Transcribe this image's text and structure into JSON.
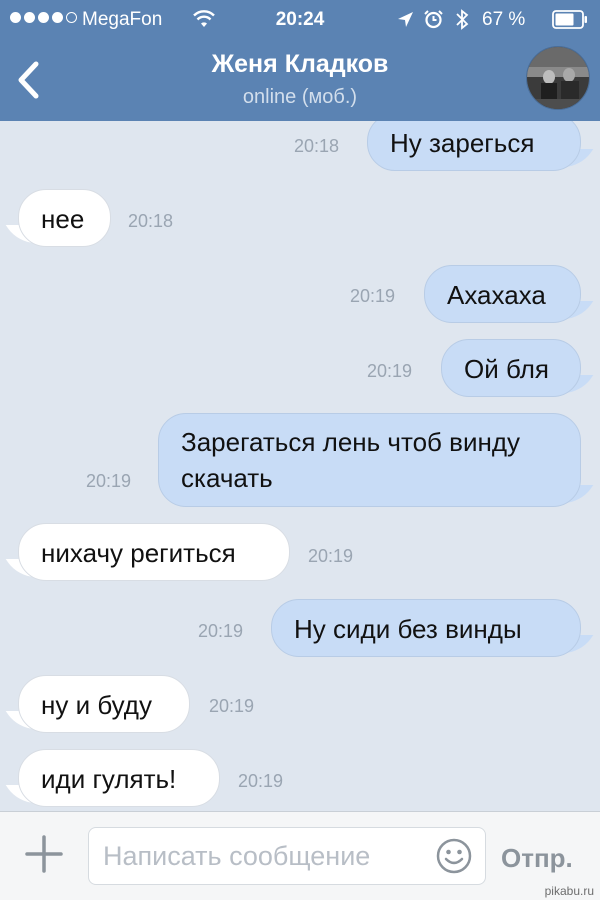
{
  "status_bar": {
    "carrier": "MegaFon",
    "time": "20:24",
    "battery": "67 %"
  },
  "header": {
    "back_icon": "chevron-left-icon",
    "contact_name": "Женя Кладков",
    "status": "online (моб.)"
  },
  "messages": [
    {
      "dir": "out",
      "text": "Ну зарегься",
      "time": "20:18"
    },
    {
      "dir": "in",
      "text": "нее",
      "time": "20:18"
    },
    {
      "dir": "out",
      "text": "Ахахаха",
      "time": "20:19"
    },
    {
      "dir": "out",
      "text": "Ой бля",
      "time": "20:19"
    },
    {
      "dir": "out",
      "text": "Зарегаться лень чтоб винду скачать",
      "time": "20:19"
    },
    {
      "dir": "in",
      "text": "нихачу региться",
      "time": "20:19"
    },
    {
      "dir": "out",
      "text": "Ну сиди без винды",
      "time": "20:19"
    },
    {
      "dir": "in",
      "text": "ну и буду",
      "time": "20:19"
    },
    {
      "dir": "in",
      "text": "иди гулять!",
      "time": "20:19"
    }
  ],
  "input": {
    "placeholder": "Написать сообщение",
    "send_label": "Отпр."
  },
  "watermark": "pikabu.ru",
  "colors": {
    "header": "#5b83b3",
    "background": "#dfe6ef",
    "outgoing_bubble": "#c8dcf6",
    "incoming_bubble": "#ffffff"
  }
}
